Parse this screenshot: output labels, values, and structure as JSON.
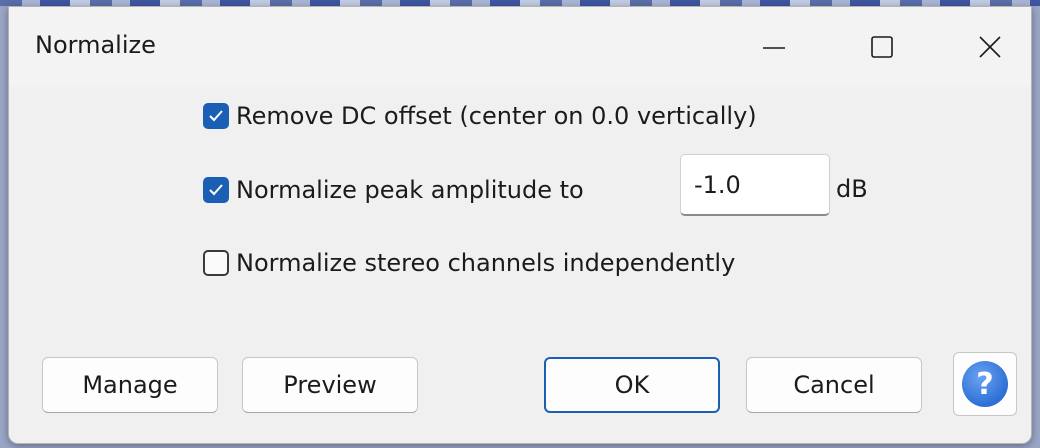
{
  "window": {
    "title": "Normalize",
    "controls": {
      "minimize": "minimize-icon",
      "maximize": "maximize-icon",
      "close": "close-icon"
    }
  },
  "options": {
    "remove_dc": {
      "label": "Remove DC offset (center on 0.0 vertically)",
      "checked": true
    },
    "normalize_peak": {
      "label": "Normalize peak amplitude to",
      "checked": true,
      "value": "-1.0",
      "unit": "dB"
    },
    "stereo_independent": {
      "label": "Normalize stereo channels independently",
      "checked": false
    }
  },
  "buttons": {
    "manage": "Manage",
    "preview": "Preview",
    "ok": "OK",
    "cancel": "Cancel",
    "help": "?"
  },
  "colors": {
    "accent": "#1a5fb4",
    "dialog_bg": "#f0f0f0",
    "help_icon": "#2d6fd6"
  }
}
